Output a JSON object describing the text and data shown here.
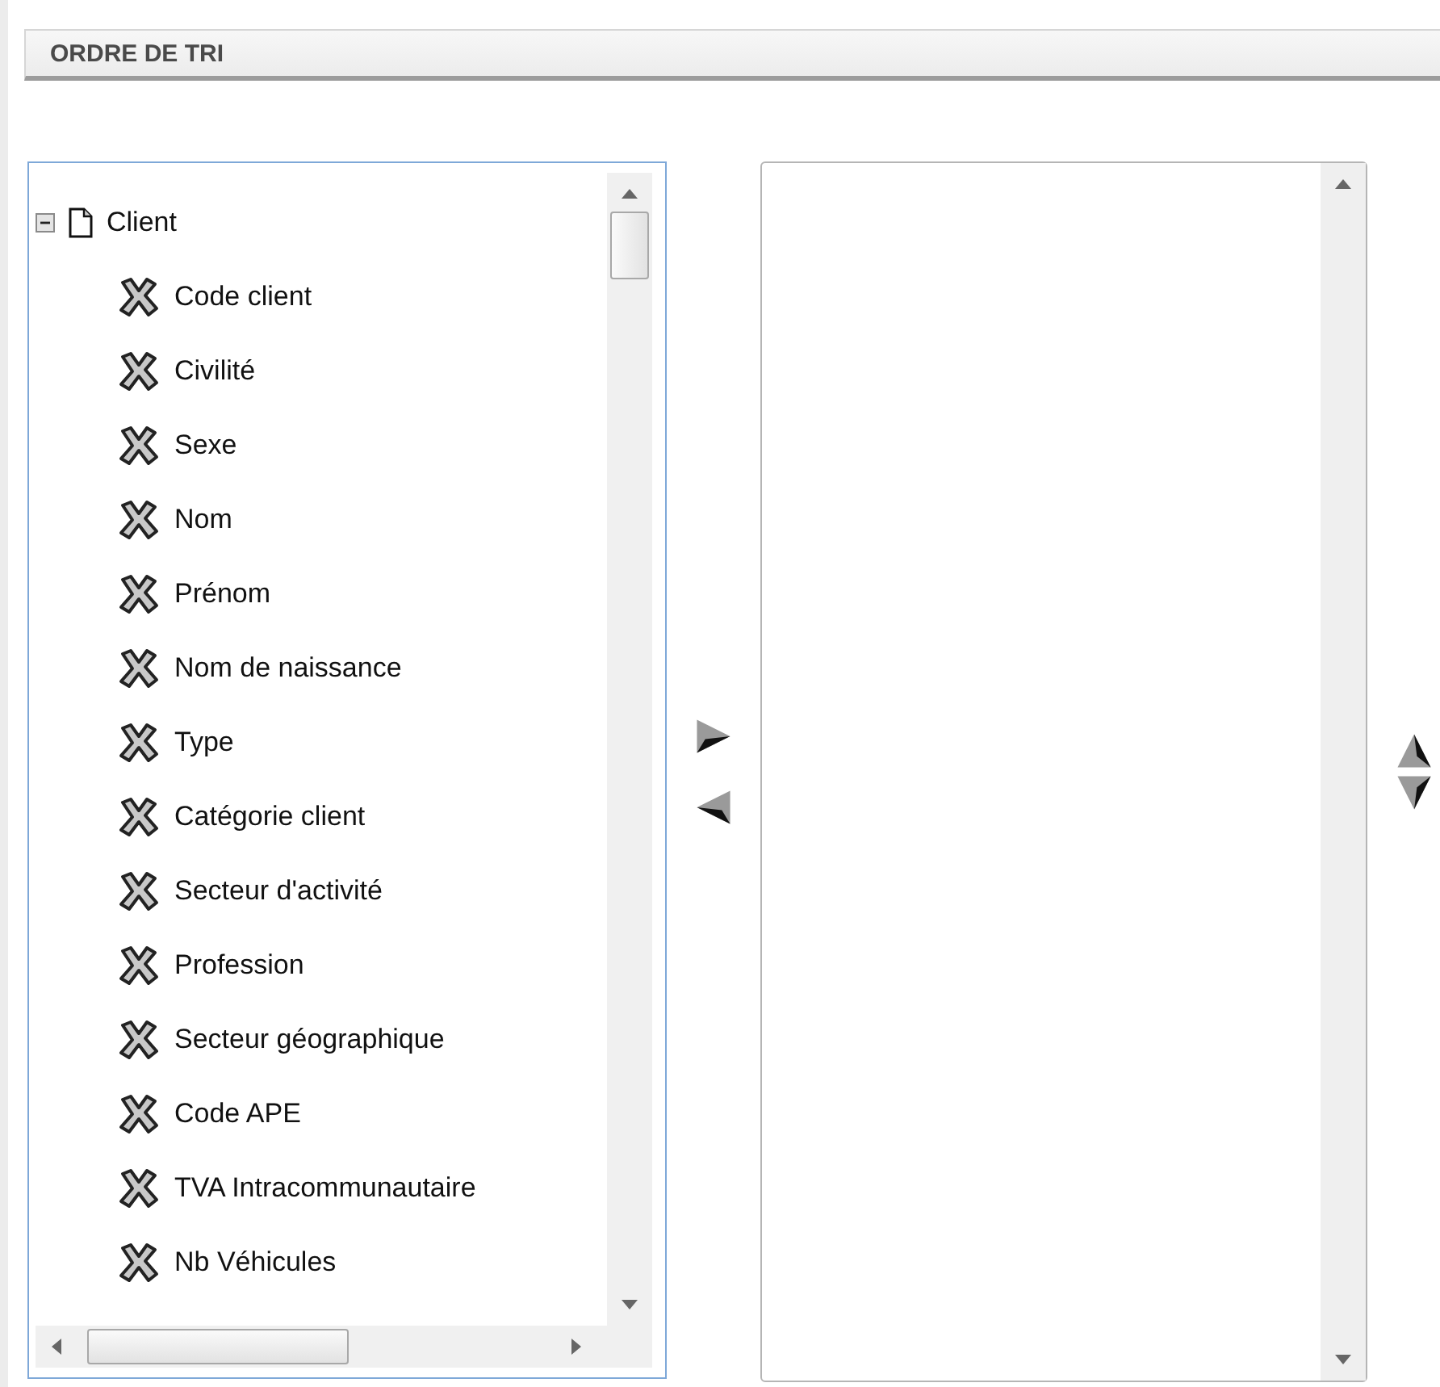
{
  "section": {
    "title": "ORDRE DE TRI"
  },
  "tree": [
    {
      "label": "Client",
      "expanded": true,
      "children": [
        {
          "label": "Code client"
        },
        {
          "label": "Civilité"
        },
        {
          "label": "Sexe"
        },
        {
          "label": "Nom"
        },
        {
          "label": "Prénom"
        },
        {
          "label": "Nom de naissance"
        },
        {
          "label": "Type"
        },
        {
          "label": "Catégorie client"
        },
        {
          "label": "Secteur d'activité"
        },
        {
          "label": "Profession"
        },
        {
          "label": "Secteur géographique"
        },
        {
          "label": "Code APE"
        },
        {
          "label": "TVA Intracommunautaire"
        },
        {
          "label": "Nb Véhicules"
        }
      ]
    }
  ]
}
